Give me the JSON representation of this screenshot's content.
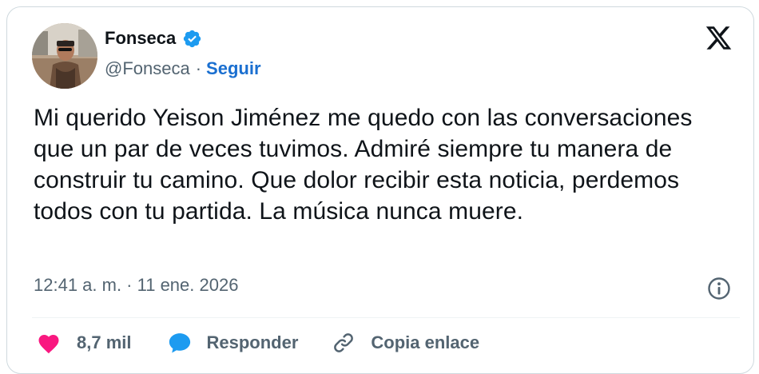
{
  "author": {
    "name": "Fonseca",
    "handle": "@Fonseca",
    "separator": "·",
    "follow_label": "Seguir",
    "verified": true,
    "verified_color": "#1d9bf0"
  },
  "tweet": {
    "text": "Mi querido Yeison Jiménez me quedo con las conversaciones que un par de veces tuvimos. Admiré siempre tu manera de construir tu camino. Que dolor recibir esta noticia, perdemos todos con tu partida. La música nunca muere.",
    "timestamp": "12:41 a. m. · 11 ene. 2026"
  },
  "actions": {
    "like_count": "8,7 mil",
    "like_color": "#f91880",
    "reply_label": "Responder",
    "reply_color": "#1d9bf0",
    "copy_label": "Copia enlace"
  },
  "icons": {
    "brand": "x-logo-icon",
    "verified": "verified-badge-icon",
    "info": "info-icon",
    "like": "heart-icon",
    "reply": "speech-bubble-icon",
    "copy": "link-icon"
  }
}
